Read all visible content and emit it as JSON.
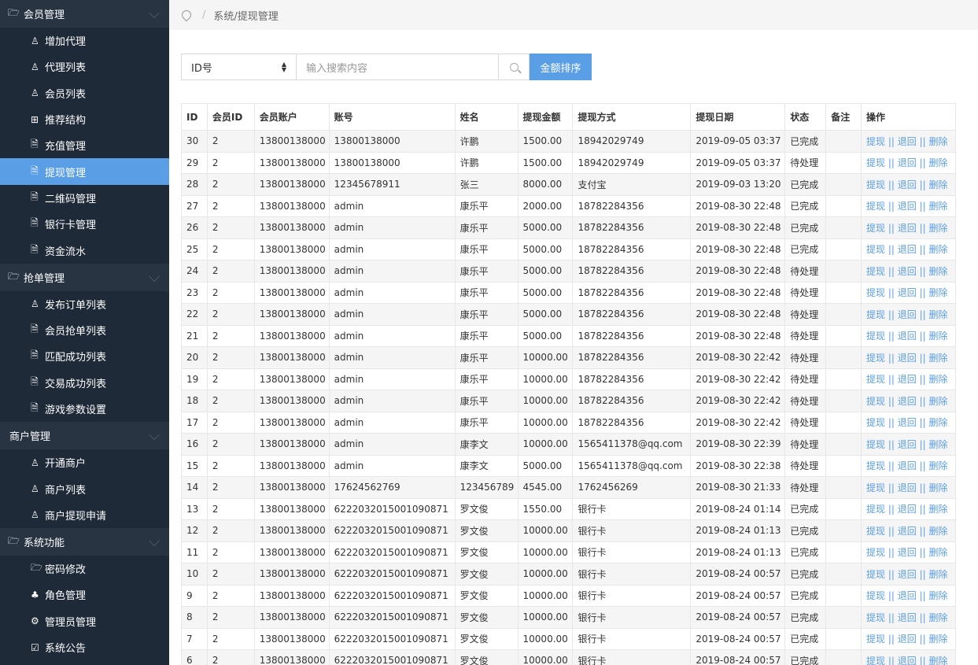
{
  "sidebar": {
    "groups": [
      {
        "title": "会员管理",
        "icon": "folder-open-icon",
        "items": [
          {
            "label": "增加代理",
            "icon": "user-icon"
          },
          {
            "label": "代理列表",
            "icon": "user-icon"
          },
          {
            "label": "会员列表",
            "icon": "user-icon"
          },
          {
            "label": "推荐结构",
            "icon": "grid-icon"
          },
          {
            "label": "充值管理",
            "icon": "document-icon"
          },
          {
            "label": "提现管理",
            "icon": "document-icon",
            "active": true
          },
          {
            "label": "二维码管理",
            "icon": "document-icon"
          },
          {
            "label": "银行卡管理",
            "icon": "document-icon"
          },
          {
            "label": "资金流水",
            "icon": "document-icon"
          }
        ]
      },
      {
        "title": "抢单管理",
        "icon": "folder-open-icon",
        "items": [
          {
            "label": "发布订单列表",
            "icon": "user-icon"
          },
          {
            "label": "会员抢单列表",
            "icon": "document-icon"
          },
          {
            "label": "匹配成功列表",
            "icon": "document-icon"
          },
          {
            "label": "交易成功列表",
            "icon": "document-icon"
          },
          {
            "label": "游戏参数设置",
            "icon": "document-icon"
          }
        ]
      },
      {
        "title": "商户管理",
        "icon": "",
        "items": [
          {
            "label": "开通商户",
            "icon": "user-icon"
          },
          {
            "label": "商户列表",
            "icon": "user-icon"
          },
          {
            "label": "商户提现申请",
            "icon": "user-icon"
          }
        ]
      },
      {
        "title": "系统功能",
        "icon": "folder-open-icon",
        "items": [
          {
            "label": "密码修改",
            "icon": "folder-open-icon"
          },
          {
            "label": "角色管理",
            "icon": "sitemap-icon"
          },
          {
            "label": "管理员管理",
            "icon": "gear-icon"
          },
          {
            "label": "系统公告",
            "icon": "checkbox-icon"
          }
        ]
      }
    ]
  },
  "breadcrumb": {
    "sep": "/",
    "path": "系统/提现管理"
  },
  "search": {
    "select_value": "ID号",
    "placeholder": "输入搜索内容",
    "sort_label": "金额排序"
  },
  "table": {
    "headers": [
      "ID",
      "会员ID",
      "会员账户",
      "账号",
      "姓名",
      "提现金额",
      "提现方式",
      "提现日期",
      "状态",
      "备注",
      "操作"
    ],
    "ops": [
      "提现",
      "退回",
      "删除"
    ],
    "rows": [
      [
        "30",
        "2",
        "13800138000",
        "13800138000",
        "许鹏",
        "1500.00",
        "18942029749",
        "2019-09-05 03:37",
        "已完成",
        ""
      ],
      [
        "29",
        "2",
        "13800138000",
        "13800138000",
        "许鹏",
        "1500.00",
        "18942029749",
        "2019-09-05 03:37",
        "待处理",
        ""
      ],
      [
        "28",
        "2",
        "13800138000",
        "12345678911",
        "张三",
        "8000.00",
        "支付宝",
        "2019-09-03 13:20",
        "已完成",
        ""
      ],
      [
        "27",
        "2",
        "13800138000",
        "admin",
        "康乐平",
        "2000.00",
        "18782284356",
        "2019-08-30 22:48",
        "已完成",
        ""
      ],
      [
        "26",
        "2",
        "13800138000",
        "admin",
        "康乐平",
        "5000.00",
        "18782284356",
        "2019-08-30 22:48",
        "已完成",
        ""
      ],
      [
        "25",
        "2",
        "13800138000",
        "admin",
        "康乐平",
        "5000.00",
        "18782284356",
        "2019-08-30 22:48",
        "已完成",
        ""
      ],
      [
        "24",
        "2",
        "13800138000",
        "admin",
        "康乐平",
        "5000.00",
        "18782284356",
        "2019-08-30 22:48",
        "待处理",
        ""
      ],
      [
        "23",
        "2",
        "13800138000",
        "admin",
        "康乐平",
        "5000.00",
        "18782284356",
        "2019-08-30 22:48",
        "待处理",
        ""
      ],
      [
        "22",
        "2",
        "13800138000",
        "admin",
        "康乐平",
        "5000.00",
        "18782284356",
        "2019-08-30 22:48",
        "待处理",
        ""
      ],
      [
        "21",
        "2",
        "13800138000",
        "admin",
        "康乐平",
        "5000.00",
        "18782284356",
        "2019-08-30 22:48",
        "待处理",
        ""
      ],
      [
        "20",
        "2",
        "13800138000",
        "admin",
        "康乐平",
        "10000.00",
        "18782284356",
        "2019-08-30 22:42",
        "待处理",
        ""
      ],
      [
        "19",
        "2",
        "13800138000",
        "admin",
        "康乐平",
        "10000.00",
        "18782284356",
        "2019-08-30 22:42",
        "待处理",
        ""
      ],
      [
        "18",
        "2",
        "13800138000",
        "admin",
        "康乐平",
        "10000.00",
        "18782284356",
        "2019-08-30 22:42",
        "待处理",
        ""
      ],
      [
        "17",
        "2",
        "13800138000",
        "admin",
        "康乐平",
        "10000.00",
        "18782284356",
        "2019-08-30 22:42",
        "待处理",
        ""
      ],
      [
        "16",
        "2",
        "13800138000",
        "admin",
        "康李文",
        "10000.00",
        "1565411378@qq.com",
        "2019-08-30 22:39",
        "待处理",
        ""
      ],
      [
        "15",
        "2",
        "13800138000",
        "admin",
        "康李文",
        "5000.00",
        "1565411378@qq.com",
        "2019-08-30 22:38",
        "待处理",
        ""
      ],
      [
        "14",
        "2",
        "13800138000",
        "17624562769",
        "123456789",
        "4545.00",
        "1762456269",
        "2019-08-30 21:33",
        "待处理",
        ""
      ],
      [
        "13",
        "2",
        "13800138000",
        "6222032015001090871",
        "罗文俊",
        "1550.00",
        "银行卡",
        "2019-08-24 01:14",
        "已完成",
        ""
      ],
      [
        "12",
        "2",
        "13800138000",
        "6222032015001090871",
        "罗文俊",
        "10000.00",
        "银行卡",
        "2019-08-24 01:13",
        "已完成",
        ""
      ],
      [
        "11",
        "2",
        "13800138000",
        "6222032015001090871",
        "罗文俊",
        "10000.00",
        "银行卡",
        "2019-08-24 01:13",
        "已完成",
        ""
      ],
      [
        "10",
        "2",
        "13800138000",
        "6222032015001090871",
        "罗文俊",
        "10000.00",
        "银行卡",
        "2019-08-24 00:57",
        "已完成",
        ""
      ],
      [
        "9",
        "2",
        "13800138000",
        "6222032015001090871",
        "罗文俊",
        "10000.00",
        "银行卡",
        "2019-08-24 00:57",
        "已完成",
        ""
      ],
      [
        "8",
        "2",
        "13800138000",
        "6222032015001090871",
        "罗文俊",
        "10000.00",
        "银行卡",
        "2019-08-24 00:57",
        "已完成",
        ""
      ],
      [
        "7",
        "2",
        "13800138000",
        "6222032015001090871",
        "罗文俊",
        "10000.00",
        "银行卡",
        "2019-08-24 00:57",
        "已完成",
        ""
      ],
      [
        "6",
        "2",
        "13800138000",
        "6222032015001090871",
        "罗文俊",
        "10000.00",
        "银行卡",
        "2019-08-24 00:57",
        "已完成",
        ""
      ]
    ]
  },
  "colors": {
    "sidebar_bg": "#1f2a38",
    "active": "#5a9ee6",
    "link": "#5a9ee6"
  }
}
